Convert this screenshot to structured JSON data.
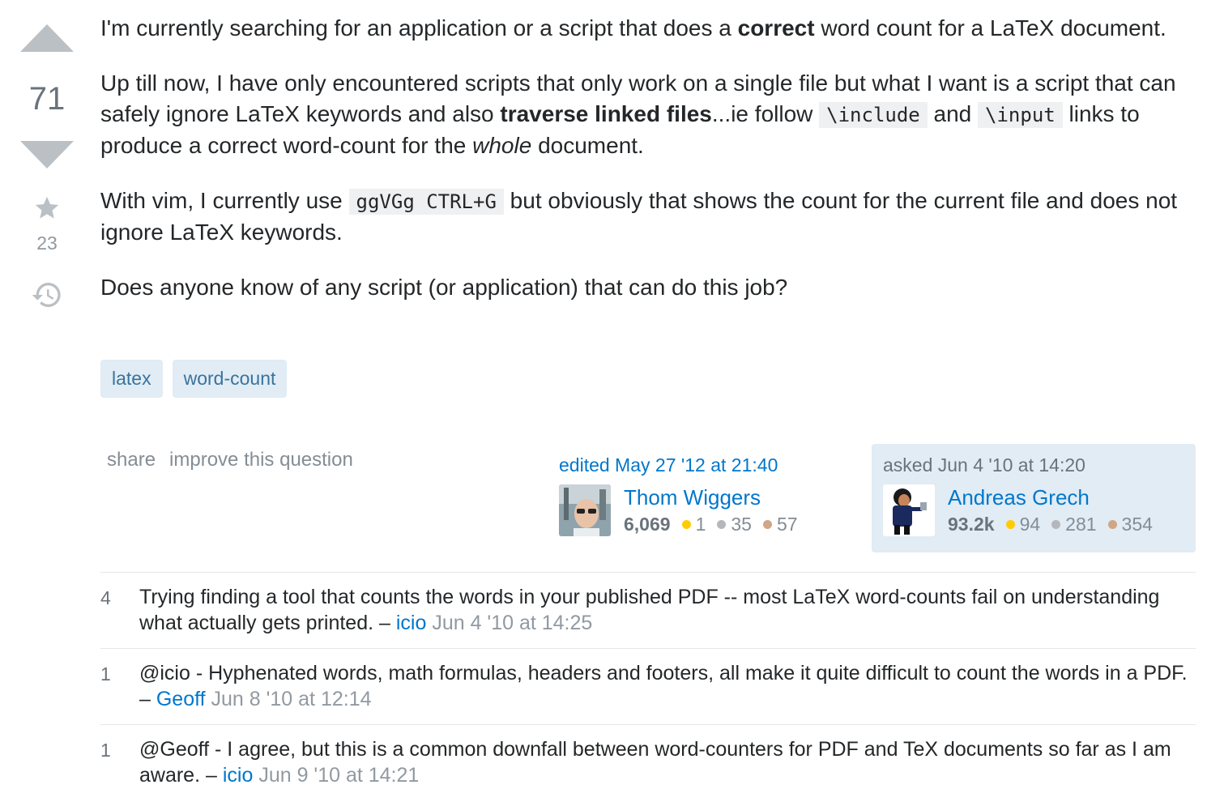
{
  "vote": {
    "score": "71",
    "favorites": "23"
  },
  "post": {
    "p1_a": "I'm currently searching for an application or a script that does a ",
    "p1_bold": "correct",
    "p1_b": " word count for a LaTeX document.",
    "p2_a": "Up till now, I have only encountered scripts that only work on a single file but what I want is a script that can safely ignore LaTeX keywords and also ",
    "p2_bold": "traverse linked files",
    "p2_b": "...ie follow ",
    "p2_code1": "\\include",
    "p2_c": " and ",
    "p2_code2": "\\input",
    "p2_d": " links to produce a correct word-count for the ",
    "p2_em": "whole",
    "p2_e": " document.",
    "p3_a": "With vim, I currently use ",
    "p3_code": "ggVGg CTRL+G",
    "p3_b": " but obviously that shows the count for the current file and does not ignore LaTeX keywords.",
    "p4": "Does anyone know of any script (or application) that can do this job?"
  },
  "tags": [
    "latex",
    "word-count"
  ],
  "menu": {
    "share": "share",
    "improve": "improve this question"
  },
  "editor": {
    "action": "edited May 27 '12 at 21:40",
    "name": "Thom Wiggers",
    "rep": "6,069",
    "gold": "1",
    "silver": "35",
    "bronze": "57"
  },
  "asker": {
    "action": "asked Jun 4 '10 at 14:20",
    "name": "Andreas Grech",
    "rep": "93.2k",
    "gold": "94",
    "silver": "281",
    "bronze": "354"
  },
  "comments": [
    {
      "score": "4",
      "text": "Trying finding a tool that counts the words in your published PDF -- most LaTeX word-counts fail on understanding what actually gets printed. – ",
      "user": "icio",
      "date": "Jun 4 '10 at 14:25"
    },
    {
      "score": "1",
      "text": "@icio - Hyphenated words, math formulas, headers and footers, all make it quite difficult to count the words in a PDF. – ",
      "user": "Geoff",
      "date": "Jun 8 '10 at 12:14"
    },
    {
      "score": "1",
      "text": "@Geoff - I agree, but this is a common downfall between word-counters for PDF and TeX documents so far as I am aware. – ",
      "user": "icio",
      "date": "Jun 9 '10 at 14:21"
    }
  ],
  "colors": {
    "gold": "#ffcc01",
    "silver": "#b4b8bc",
    "bronze": "#d1a684",
    "link": "#0077cc",
    "tag_bg": "#e1ecf4"
  }
}
